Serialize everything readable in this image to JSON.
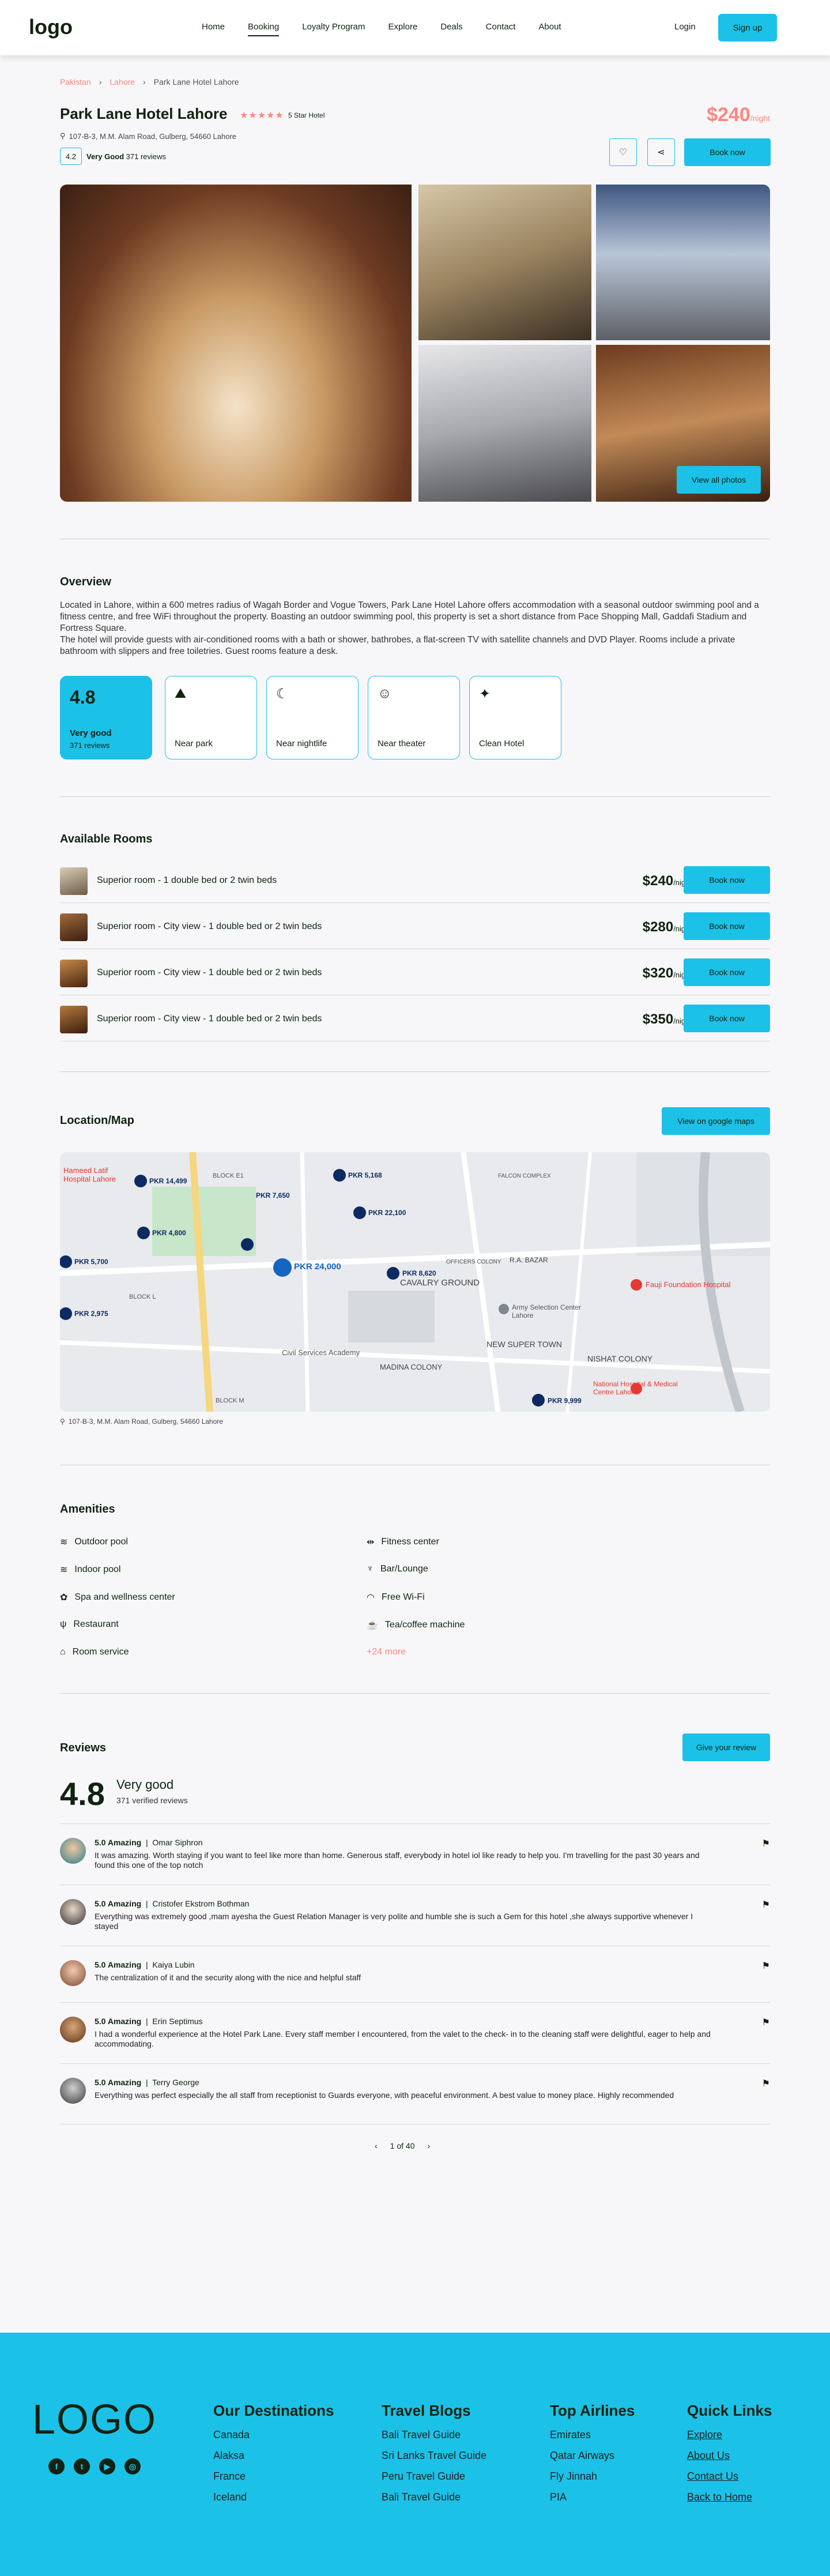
{
  "header": {
    "logo": "logo",
    "nav": [
      "Home",
      "Booking",
      "Loyalty Program",
      "Explore",
      "Deals",
      "Contact",
      "About"
    ],
    "login": "Login",
    "signup": "Sign up"
  },
  "breadcrumb": [
    "Pakistan",
    "Lahore",
    "Park Lane Hotel Lahore"
  ],
  "hotel": {
    "name": "Park Lane Hotel Lahore",
    "stars": "★★★★★",
    "star_label": "5 Star Hotel",
    "address": "107-B-3, M.M. Alam Road, Gulberg, 54660 Lahore",
    "rating": "4.2",
    "rating_word": "Very Good",
    "reviews": "371 reviews",
    "price": "$240",
    "per": "/night",
    "book": "Book now",
    "view_all": "View all photos"
  },
  "overview": {
    "title": "Overview",
    "text": "Located in Lahore, within a 600 metres radius of Wagah Border and Vogue Towers, Park Lane Hotel Lahore offers accommodation with a seasonal outdoor swimming pool and a fitness centre, and free WiFi throughout the property. Boasting an outdoor swimming pool, this property is set a short distance from Pace Shopping Mall, Gaddafi Stadium and Fortress Square.\nThe hotel will provide guests with air-conditioned rooms with a bath or shower, bathrobes, a flat-screen TV with satellite channels and DVD Player. Rooms include a private bathroom with slippers and free toiletries. Guest rooms feature a desk.",
    "score": "4.8",
    "score_word": "Very good",
    "score_reviews": "371 reviews",
    "features": [
      "Near park",
      "Near nightlife",
      "Near theater",
      "Clean Hotel"
    ]
  },
  "rooms": {
    "title": "Available Rooms",
    "list": [
      {
        "name": "Superior room - 1 double bed or 2 twin beds",
        "price": "$240",
        "per": "/night",
        "book": "Book now"
      },
      {
        "name": "Superior room - City view  - 1 double bed or 2 twin beds",
        "price": "$280",
        "per": "/night",
        "book": "Book now"
      },
      {
        "name": "Superior room - City view - 1 double bed or 2 twin beds",
        "price": "$320",
        "per": "/night",
        "book": "Book now"
      },
      {
        "name": "Superior room - City view - 1 double bed or 2 twin beds",
        "price": "$350",
        "per": "/night",
        "book": "Book now"
      }
    ]
  },
  "location": {
    "title": "Location/Map",
    "button": "View on google maps",
    "address": "107-B-3, M.M. Alam Road, Gulberg, 54660 Lahore",
    "map_labels": [
      "Hameed Latif Hospital Lahore",
      "PKR 14,499",
      "PKR 5,168",
      "PKR 7,650",
      "PKR 22,100",
      "PKR 4,800",
      "PKR 5,700",
      "PKR 24,000",
      "PKR 8,620",
      "PKR 2,975",
      "CAVALRY GROUND",
      "R.A. BAZAR",
      "Army Selection Center Lahore",
      "Fauji Foundation Hospital",
      "NEW SUPER TOWN",
      "NISHAT COLONY",
      "MADINA COLONY",
      "Civil Services Academy",
      "National Hospital & Medical Centre Lahore",
      "PKR 9,999",
      "FALCON COMPLEX",
      "OFFICERS COLONY",
      "BLOCK M",
      "BLOCK L",
      "BLOCK E1"
    ]
  },
  "amenities": {
    "title": "Amenities",
    "left": [
      "Outdoor pool",
      "Indoor pool",
      "Spa and wellness center",
      "Restaurant",
      "Room service"
    ],
    "right": [
      "Fitness center",
      "Bar/Lounge",
      "Free Wi-Fi",
      "Tea/coffee machine",
      "+24 more"
    ]
  },
  "reviews": {
    "title": "Reviews",
    "button": "Give your review",
    "score": "4.8",
    "word": "Very good",
    "verified": "371 verified reviews",
    "list": [
      {
        "rating": "5.0 Amazing",
        "name": "Omar Siphron",
        "text": "It was amazing. Worth staying if you want to feel like more than home. Generous staff, everybody in hotel iol like ready to help you. I'm travelling for the past 30 years and found this one of the top notch"
      },
      {
        "rating": "5.0 Amazing",
        "name": "Cristofer Ekstrom Bothman",
        "text": "Everything was extremely good ,mam ayesha the Guest Relation Manager is very polite and humble she is such a Gem for this hotel ,she always supportive whenever I stayed"
      },
      {
        "rating": "5.0 Amazing",
        "name": "Kaiya Lubin",
        "text": "The centralization of it and the security along with the nice and helpful staff"
      },
      {
        "rating": "5.0 Amazing",
        "name": "Erin Septimus",
        "text": "I had a wonderful experience at the Hotel Park Lane. Every staff member I encountered, from the valet to the check- in to the cleaning staff were delightful, eager to help and accommodating."
      },
      {
        "rating": "5.0 Amazing",
        "name": "Terry George",
        "text": "Everything was perfect especially the all staff from receptionist to Guards everyone, with peaceful environment. A best value to money place. Highly recommended"
      }
    ],
    "pager": "1 of 40"
  },
  "footer": {
    "logo": "LOGO",
    "social": [
      "f",
      "t",
      "▶",
      "◎"
    ],
    "cols": [
      {
        "title": "Our Destinations",
        "items": [
          "Canada",
          "Alaksa",
          "France",
          "Iceland"
        ]
      },
      {
        "title": "Travel Blogs",
        "items": [
          "Bali Travel Guide",
          "Sri Lanks Travel Guide",
          "Peru Travel Guide",
          "Bali Travel Guide"
        ]
      },
      {
        "title": "Top Airlines",
        "items": [
          "Emirates",
          "Qatar Airways",
          "Fly Jinnah",
          "PIA"
        ]
      },
      {
        "title": "Quick Links",
        "items": [
          "Explore",
          "About Us",
          "Contact Us",
          "Back to Home"
        ]
      }
    ]
  }
}
